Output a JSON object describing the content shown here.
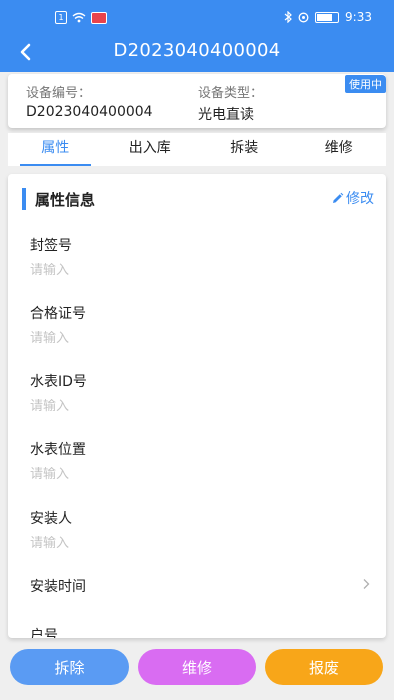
{
  "status_bar": {
    "time": "9:33",
    "sim_label": "1"
  },
  "header": {
    "title": "D2023040400004"
  },
  "device_info": {
    "status_badge": "使用中",
    "device_no_label": "设备编号：",
    "device_no_value": "D2023040400004",
    "device_type_label": "设备类型：",
    "device_type_value": "光电直读"
  },
  "tabs": [
    {
      "label": "属性",
      "active": true
    },
    {
      "label": "出入库",
      "active": false
    },
    {
      "label": "拆装",
      "active": false
    },
    {
      "label": "维修",
      "active": false
    }
  ],
  "section": {
    "title": "属性信息",
    "edit_label": "修改"
  },
  "fields": [
    {
      "label": "封签号",
      "placeholder": "请输入"
    },
    {
      "label": "合格证号",
      "placeholder": "请输入"
    },
    {
      "label": "水表ID号",
      "placeholder": "请输入"
    },
    {
      "label": "水表位置",
      "placeholder": "请输入"
    },
    {
      "label": "安装人",
      "placeholder": "请输入"
    },
    {
      "label": "安装时间",
      "placeholder": ""
    },
    {
      "label": "户号",
      "placeholder": ""
    }
  ],
  "buttons": {
    "remove": "拆除",
    "repair": "维修",
    "scrap": "报废"
  },
  "colors": {
    "primary": "#3b8cf1",
    "repair": "#d96cf2",
    "scrap": "#f8a619"
  }
}
